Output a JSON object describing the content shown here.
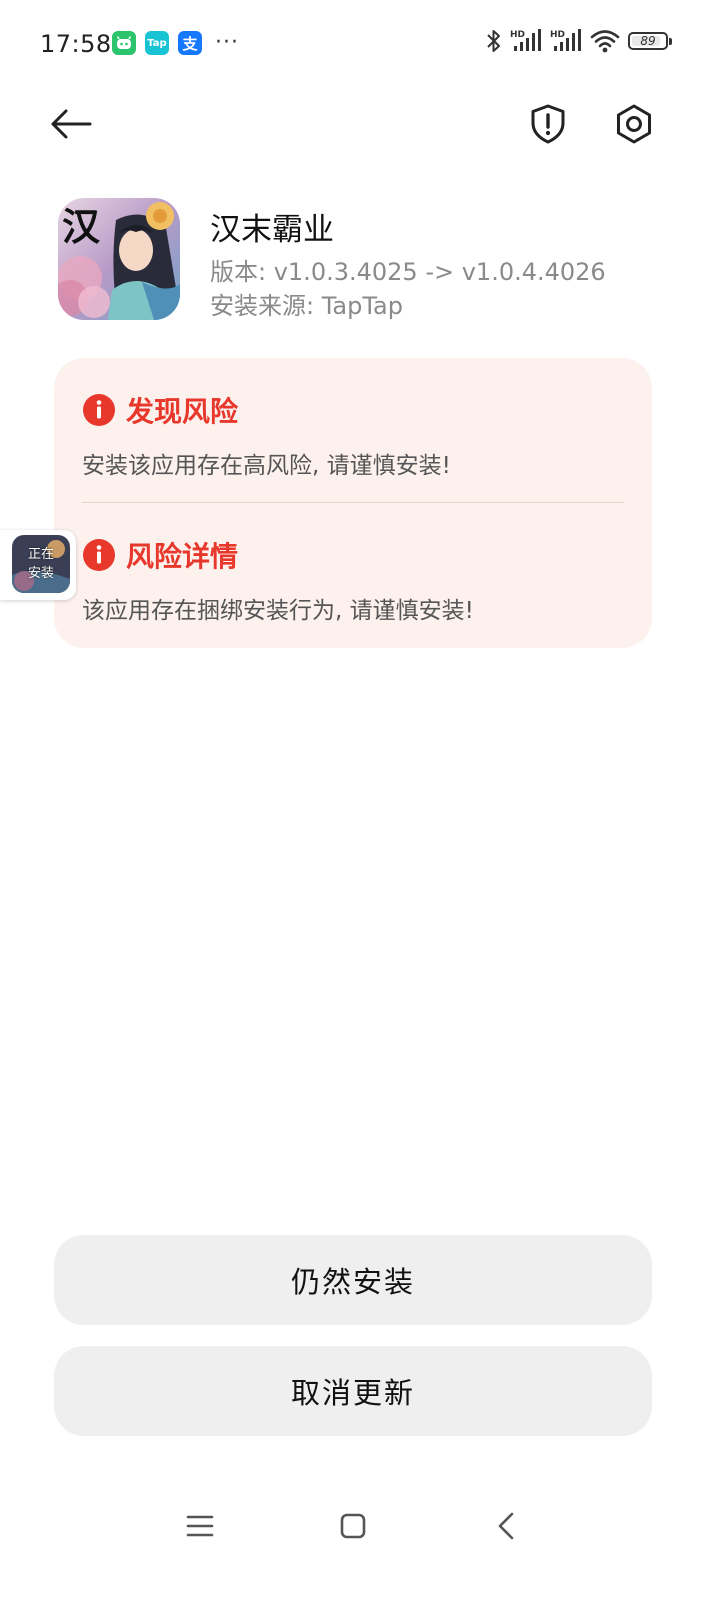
{
  "status_bar": {
    "time": "17:58",
    "notification_icons": [
      {
        "name": "android-robot-icon",
        "color": "#2bc36b"
      },
      {
        "name": "taptap-icon",
        "label": "Tap",
        "color": "#18c3d4"
      },
      {
        "name": "alipay-icon",
        "label": "支",
        "color": "#1677ff"
      }
    ],
    "more_notifications": "···",
    "signal_label_1": "HD",
    "signal_label_2": "HD",
    "battery_level": "89"
  },
  "app": {
    "name": "汉末霸业",
    "version": "版本: v1.0.3.4025 -> v1.0.4.4026",
    "source": "安装来源: TapTap",
    "icon_glyph": "汉"
  },
  "risks": [
    {
      "title": "发现风险",
      "description": "安装该应用存在高风险, 请谨慎安装!"
    },
    {
      "title": "风险详情",
      "description": "该应用存在捆绑安装行为, 请谨慎安装!"
    }
  ],
  "install_badge": {
    "line1": "正在",
    "line2": "安装"
  },
  "buttons": {
    "install_anyway": "仍然安装",
    "cancel_update": "取消更新"
  },
  "colors": {
    "risk_red": "#e8382c",
    "card_background": "#fdf1ee",
    "button_background": "#efefef"
  }
}
